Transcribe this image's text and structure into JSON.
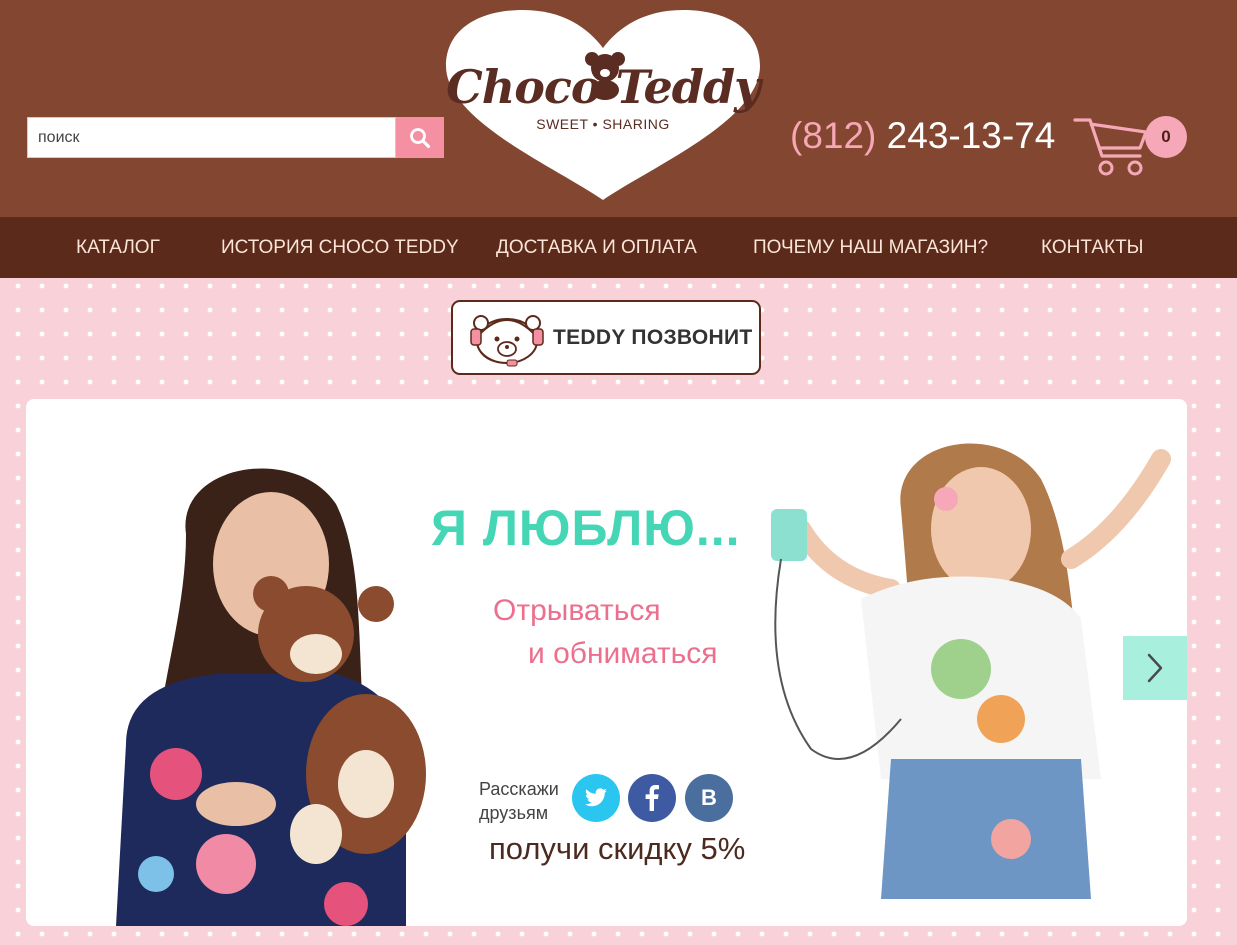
{
  "search": {
    "placeholder": "поиск"
  },
  "logo": {
    "name": "Choco Teddy",
    "tagline": "SWEET • SHARING"
  },
  "contact": {
    "phone_code": "(812)",
    "phone_number": "243-13-74"
  },
  "cart": {
    "count": "0"
  },
  "nav": {
    "items": [
      {
        "label": "Каталог"
      },
      {
        "label": "История Choco Teddy"
      },
      {
        "label": "Доставка и оплата"
      },
      {
        "label": "Почему наш магазин?"
      },
      {
        "label": "Контакты"
      }
    ]
  },
  "callback": {
    "label": "TEDDY ПОЗВОНИТ"
  },
  "banner": {
    "headline": "Я ЛЮБЛЮ...",
    "subline1": "Отрываться",
    "subline2": "и обниматься",
    "share_line1": "Расскажи",
    "share_line2": "друзьям",
    "discount": "получи скидку 5%",
    "social": [
      "twitter-icon",
      "facebook-icon",
      "vk-icon"
    ],
    "vk_glyph": "B"
  },
  "colors": {
    "header_bg": "#824631",
    "nav_bg": "#5b2a1b",
    "accent_pink": "#f590a3",
    "headline_teal": "#45d6b5",
    "subline_pink": "#ec6f8e"
  }
}
